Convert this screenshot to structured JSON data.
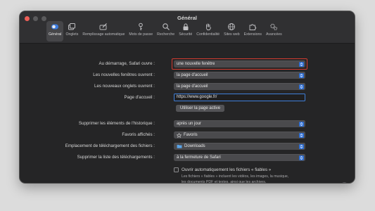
{
  "window": {
    "title": "Général"
  },
  "tabs": [
    {
      "label": "Général",
      "icon": "switch-icon",
      "active": true
    },
    {
      "label": "Onglets",
      "icon": "tabs-icon"
    },
    {
      "label": "Remplissage automatique",
      "icon": "pencil-icon"
    },
    {
      "label": "Mots de passe",
      "icon": "key-icon"
    },
    {
      "label": "Recherche",
      "icon": "search-icon"
    },
    {
      "label": "Sécurité",
      "icon": "lock-icon"
    },
    {
      "label": "Confidentialité",
      "icon": "hand-icon"
    },
    {
      "label": "Sites web",
      "icon": "globe-icon"
    },
    {
      "label": "Extensions",
      "icon": "puzzle-icon"
    },
    {
      "label": "Avancées",
      "icon": "gears-icon"
    }
  ],
  "settings": {
    "startup_label": "Au démarrage, Safari ouvre :",
    "startup_value": "une nouvelle fenêtre",
    "new_windows_label": "Les nouvelles fenêtres ouvrent :",
    "new_windows_value": "la page d'accueil",
    "new_tabs_label": "Les nouveaux onglets ouvrent :",
    "new_tabs_value": "la page d'accueil",
    "homepage_label": "Page d'accueil :",
    "homepage_value": "https://www.google.fr/",
    "use_current_page": "Utiliser la page active",
    "history_label": "Supprimer les éléments de l'historique :",
    "history_value": "après un jour",
    "favorites_label": "Favoris affichés :",
    "favorites_value": "Favoris",
    "download_location_label": "Emplacement de téléchargement des fichiers :",
    "download_location_value": "Downloads",
    "download_list_label": "Supprimer la liste des téléchargements :",
    "download_list_value": "à la fermeture de Safari",
    "safe_files_label": "Ouvrir automatiquement les fichiers « fiables »",
    "safe_files_checked": false,
    "safe_files_desc": "Les fichiers « fiables » incluent les vidéos, les images, la musique, les documents PDF et textes, ainsi que les archives."
  },
  "help": "?",
  "colors": {
    "accent": "#2f6fd4",
    "highlight": "#d23b30",
    "window_bg": "#252526"
  }
}
